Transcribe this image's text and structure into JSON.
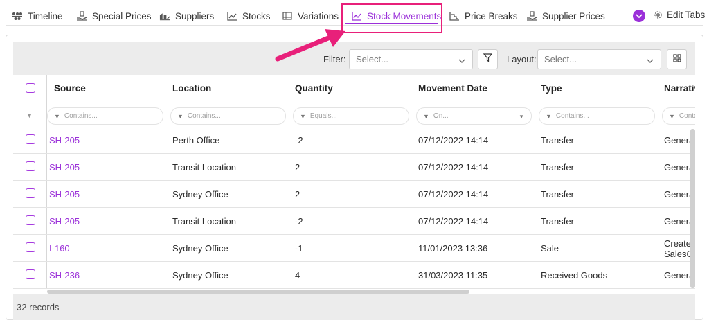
{
  "tabs": [
    {
      "label": "Timeline",
      "icon": "timeline-icon"
    },
    {
      "label": "Special Prices",
      "icon": "hand-price-icon"
    },
    {
      "label": "Suppliers",
      "icon": "supplier-icon"
    },
    {
      "label": "Stocks",
      "icon": "chart-line-icon"
    },
    {
      "label": "Variations",
      "icon": "table-icon"
    },
    {
      "label": "Stock Movements",
      "icon": "chart-area-icon",
      "active": true
    },
    {
      "label": "Price Breaks",
      "icon": "price-break-icon"
    },
    {
      "label": "Supplier Prices",
      "icon": "hand-price-icon"
    }
  ],
  "edit_tabs_label": "Edit Tabs",
  "toolbar": {
    "filter_label": "Filter:",
    "filter_placeholder": "Select...",
    "layout_label": "Layout:",
    "layout_placeholder": "Select..."
  },
  "columns": [
    "Source",
    "Location",
    "Quantity",
    "Movement Date",
    "Type",
    "Narrative"
  ],
  "column_filters": [
    "Contains...",
    "Contains...",
    "Equals...",
    "On...",
    "Contains...",
    "Contains..."
  ],
  "rows": [
    {
      "source": "SH-205",
      "location": "Perth Office",
      "quantity": "-2",
      "date": "07/12/2022 14:14",
      "type": "Transfer",
      "narrative": "General"
    },
    {
      "source": "SH-205",
      "location": "Transit Location",
      "quantity": "2",
      "date": "07/12/2022 14:14",
      "type": "Transfer",
      "narrative": "General"
    },
    {
      "source": "SH-205",
      "location": "Sydney Office",
      "quantity": "2",
      "date": "07/12/2022 14:14",
      "type": "Transfer",
      "narrative": "General"
    },
    {
      "source": "SH-205",
      "location": "Transit Location",
      "quantity": "-2",
      "date": "07/12/2022 14:14",
      "type": "Transfer",
      "narrative": "General"
    },
    {
      "source": "I-160",
      "location": "Sydney Office",
      "quantity": "-1",
      "date": "11/01/2023 13:36",
      "type": "Sale",
      "narrative": "Created SalesO"
    },
    {
      "source": "SH-236",
      "location": "Sydney Office",
      "quantity": "4",
      "date": "31/03/2023 11:35",
      "type": "Received Goods",
      "narrative": "General"
    }
  ],
  "records_label": "32 records",
  "colors": {
    "accent": "#9b30d9",
    "annotation": "#e8207a"
  }
}
